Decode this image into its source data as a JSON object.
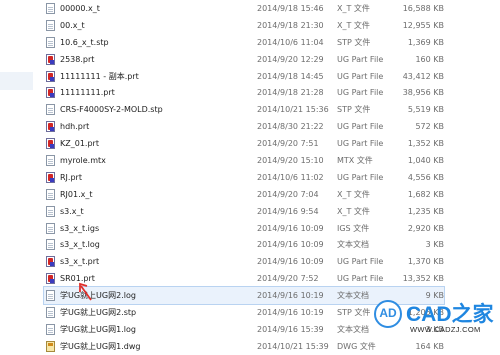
{
  "files": [
    {
      "name": "00000.x_t",
      "date": "2014/9/18 15:46",
      "type": "X_T 文件",
      "size": "16,588 KB",
      "icon": "doc"
    },
    {
      "name": "00.x_t",
      "date": "2014/9/18 21:30",
      "type": "X_T 文件",
      "size": "12,955 KB",
      "icon": "doc"
    },
    {
      "name": "10.6_x_t.stp",
      "date": "2014/10/6 11:04",
      "type": "STP 文件",
      "size": "1,369 KB",
      "icon": "doc"
    },
    {
      "name": "2538.prt",
      "date": "2014/9/20 12:29",
      "type": "UG Part File",
      "size": "160 KB",
      "icon": "ug"
    },
    {
      "name": "11111111 - 副本.prt",
      "date": "2014/9/18 14:45",
      "type": "UG Part File",
      "size": "43,412 KB",
      "icon": "ug"
    },
    {
      "name": "11111111.prt",
      "date": "2014/9/18 21:28",
      "type": "UG Part File",
      "size": "38,956 KB",
      "icon": "ug"
    },
    {
      "name": "CRS-F4000SY-2-MOLD.stp",
      "date": "2014/10/21 15:36",
      "type": "STP 文件",
      "size": "5,519 KB",
      "icon": "doc"
    },
    {
      "name": "hdh.prt",
      "date": "2014/8/30 21:22",
      "type": "UG Part File",
      "size": "572 KB",
      "icon": "ug"
    },
    {
      "name": "KZ_01.prt",
      "date": "2014/9/20 7:51",
      "type": "UG Part File",
      "size": "1,352 KB",
      "icon": "ug"
    },
    {
      "name": "myrole.mtx",
      "date": "2014/9/20 15:10",
      "type": "MTX 文件",
      "size": "1,040 KB",
      "icon": "doc"
    },
    {
      "name": "RJ.prt",
      "date": "2014/10/6 11:02",
      "type": "UG Part File",
      "size": "4,556 KB",
      "icon": "ug"
    },
    {
      "name": "RJ01.x_t",
      "date": "2014/9/20 7:04",
      "type": "X_T 文件",
      "size": "1,682 KB",
      "icon": "doc"
    },
    {
      "name": "s3.x_t",
      "date": "2014/9/16 9:54",
      "type": "X_T 文件",
      "size": "1,235 KB",
      "icon": "doc"
    },
    {
      "name": "s3_x_t.igs",
      "date": "2014/9/16 10:09",
      "type": "IGS 文件",
      "size": "2,920 KB",
      "icon": "doc"
    },
    {
      "name": "s3_x_t.log",
      "date": "2014/9/16 10:09",
      "type": "文本文档",
      "size": "3 KB",
      "icon": "doc"
    },
    {
      "name": "s3_x_t.prt",
      "date": "2014/9/16 10:09",
      "type": "UG Part File",
      "size": "1,370 KB",
      "icon": "ug"
    },
    {
      "name": "SR01.prt",
      "date": "2014/9/20 7:52",
      "type": "UG Part File",
      "size": "13,352 KB",
      "icon": "ug"
    },
    {
      "name": "学UG就上UG网2.log",
      "date": "2014/9/16 10:19",
      "type": "文本文档",
      "size": "9 KB",
      "icon": "doc",
      "highlighted": true
    },
    {
      "name": "学UG就上UG网2.stp",
      "date": "2014/9/16 10:19",
      "type": "STP 文件",
      "size": "1,205 KB",
      "icon": "doc"
    },
    {
      "name": "学UG就上UG网1.log",
      "date": "2014/9/16 15:39",
      "type": "文本文档",
      "size": "3 KB",
      "icon": "doc"
    },
    {
      "name": "学UG就上UG网1.dwg",
      "date": "2014/10/21 15:39",
      "type": "DWG 文件",
      "size": "164 KB",
      "icon": "dwg"
    }
  ],
  "watermark": {
    "badge": "AD",
    "brand": "CAD之家",
    "url": "WWW.CADZJ.COM"
  }
}
